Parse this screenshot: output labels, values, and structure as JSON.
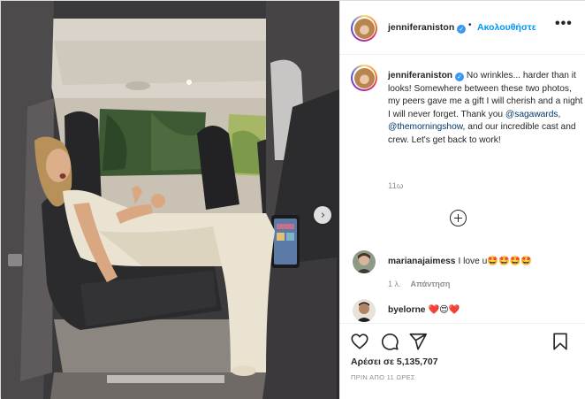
{
  "post": {
    "username": "jenniferaniston",
    "verified": true,
    "follow_label": "Ακολουθήστε",
    "more_label": "•••"
  },
  "caption": {
    "username": "jenniferaniston",
    "segments": {
      "s1": "No wrinkles... harder than it looks! Somewhere between these two photos, my peers gave me a gift I will cherish and a night I will never forget. Thank you ",
      "m1": "@sagawards",
      "s2": ", ",
      "m2": "@themorningshow",
      "s3": ", and our incredible cast and crew. Let's get back to work!"
    },
    "time": "11ω"
  },
  "comments": [
    {
      "username": "marianajaimess",
      "text": "I love u🤩🤩🤩🤩",
      "time": "1 λ.",
      "reply_label": "Απάντηση"
    },
    {
      "username": "byelorne",
      "text": "❤️😍❤️"
    }
  ],
  "likes": {
    "text": "Αρέσει σε 5,135,707"
  },
  "timestamp": "ΠΡΙΝ ΑΠΟ 11 ΩΡΕΣ",
  "icons": {
    "like": "heart-icon",
    "comment": "comment-bubble-icon",
    "share": "paper-plane-icon",
    "save": "bookmark-icon",
    "next": "chevron-right-icon",
    "load_more": "plus-circle-icon"
  },
  "colors": {
    "link": "#0095f6",
    "mention": "#00376b",
    "muted": "#8e8e8e",
    "verified": "#3897f0"
  }
}
